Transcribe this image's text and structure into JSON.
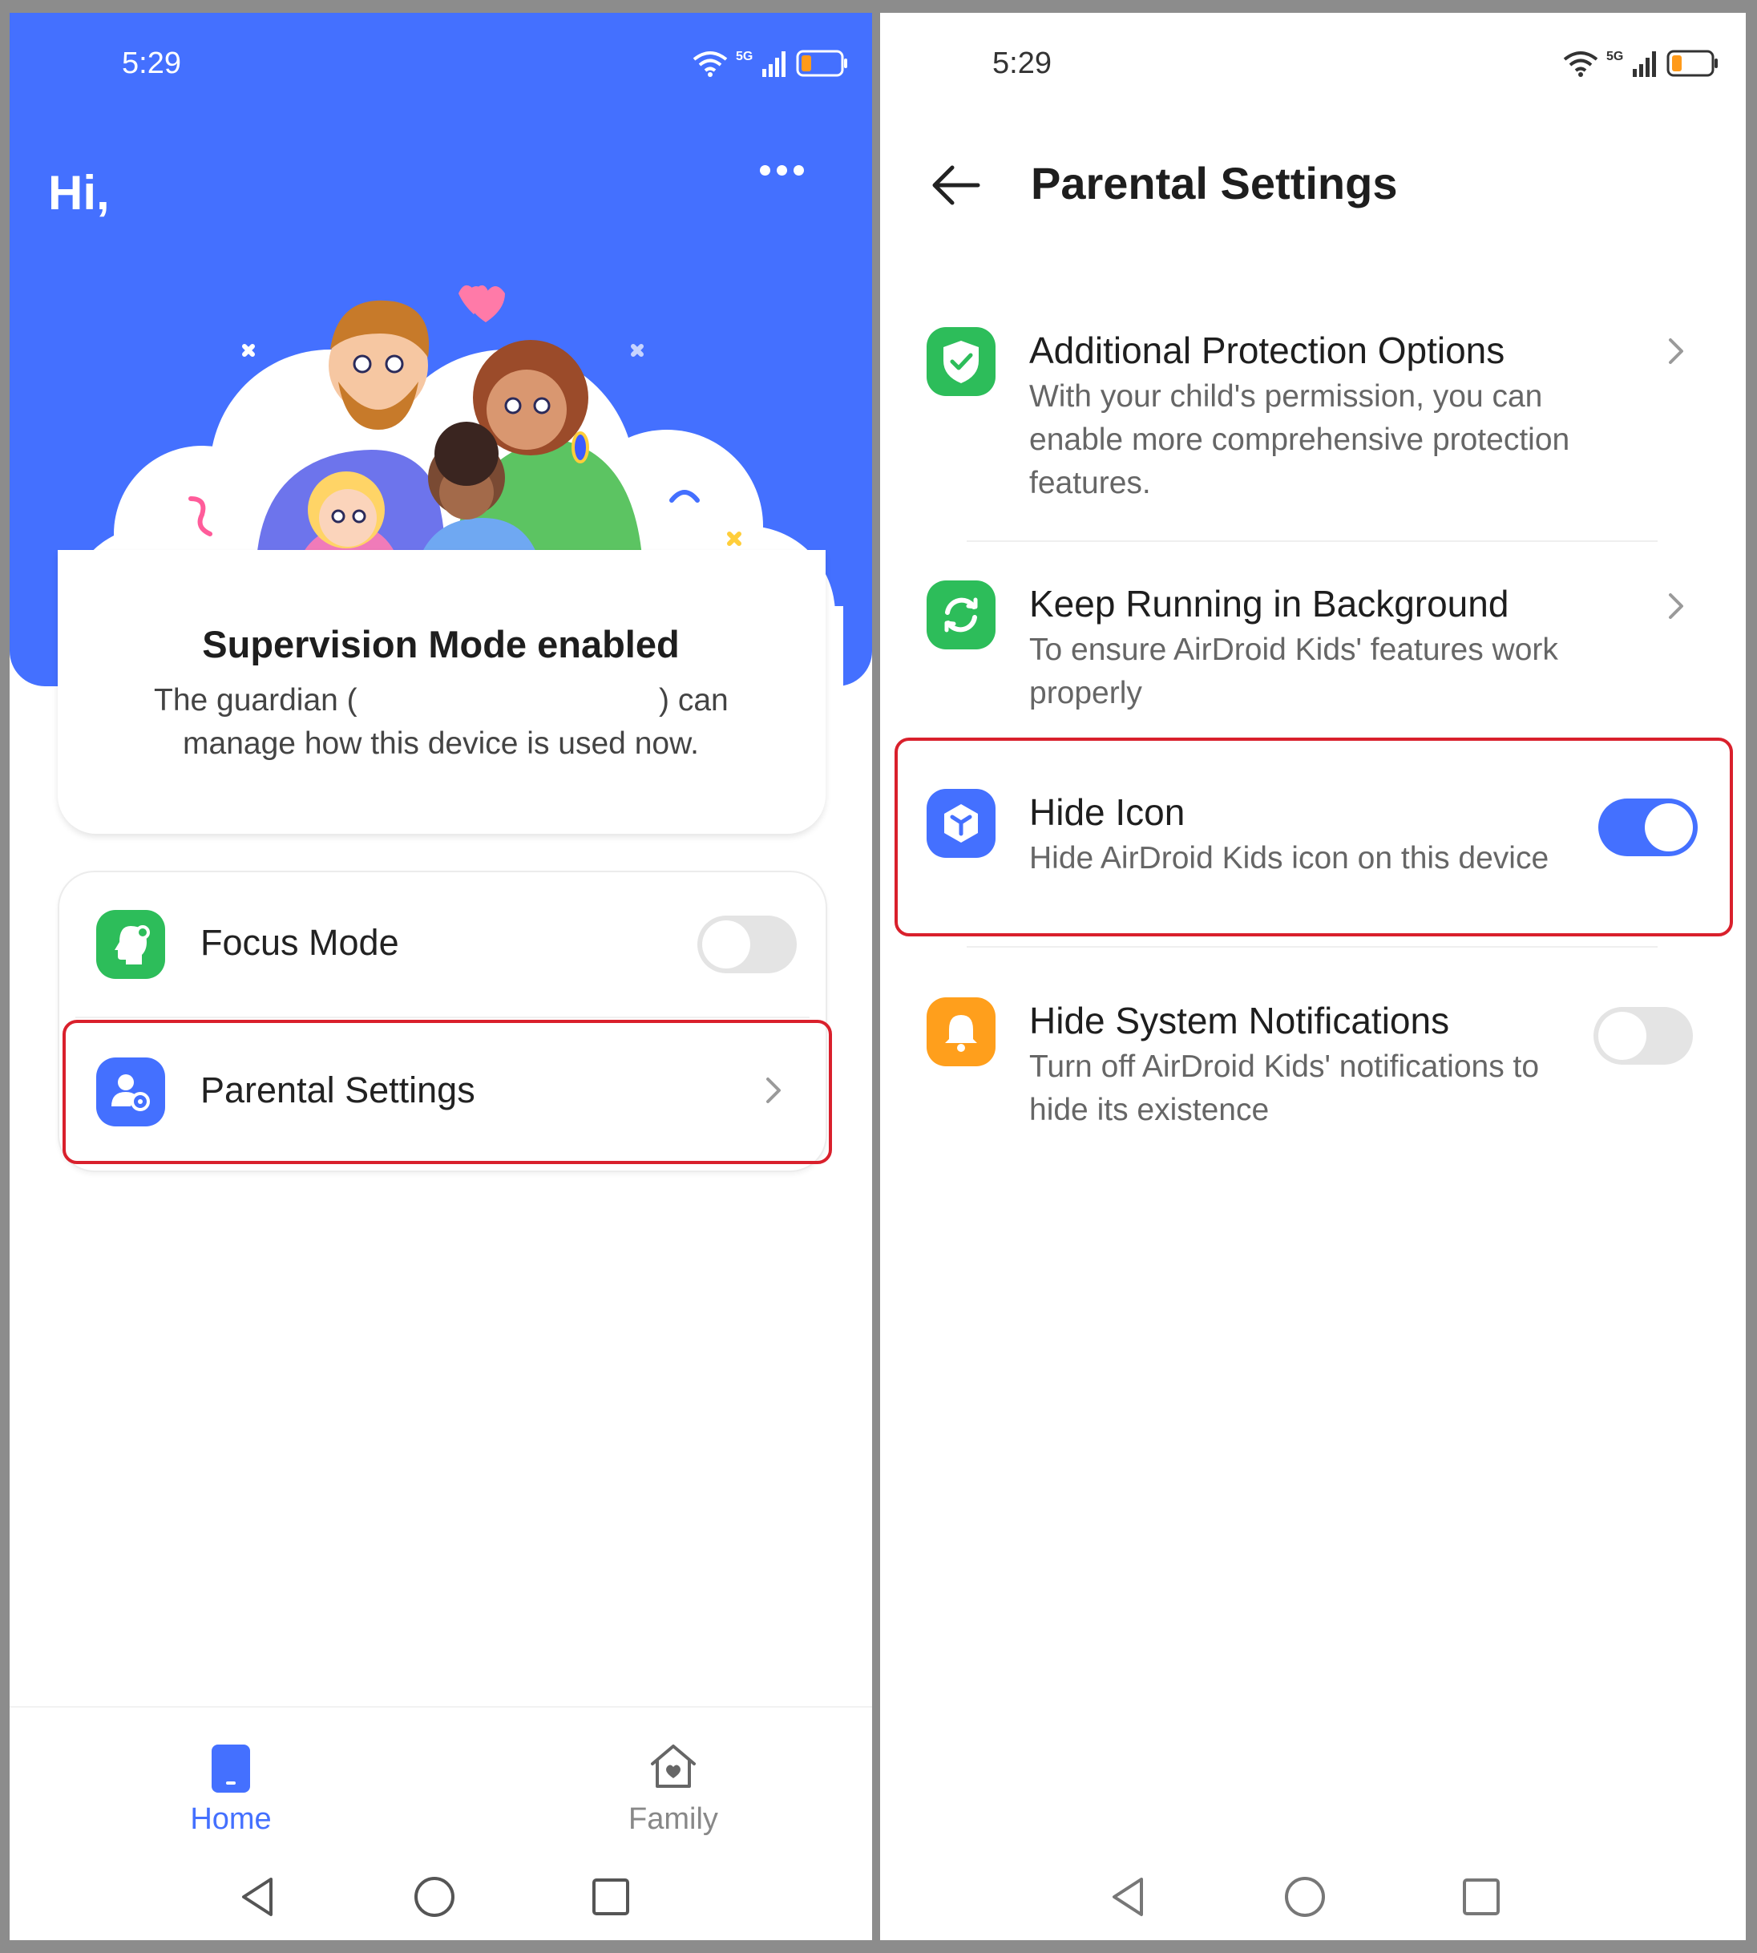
{
  "left": {
    "status": {
      "time": "5:29",
      "network": "5G"
    },
    "header": {
      "greeting": "Hi,"
    },
    "supervision": {
      "title": "Supervision Mode enabled",
      "text_prefix": "The guardian (",
      "text_suffix": ") can",
      "text_line2": "manage how this device is used now."
    },
    "menu": {
      "focus_mode": {
        "label": "Focus Mode",
        "enabled": false
      },
      "parental_settings": {
        "label": "Parental Settings"
      }
    },
    "tabs": [
      {
        "label": "Home",
        "active": true
      },
      {
        "label": "Family",
        "active": false
      }
    ]
  },
  "right": {
    "status": {
      "time": "5:29",
      "network": "5G"
    },
    "header": {
      "title": "Parental Settings"
    },
    "items": [
      {
        "title": "Additional Protection Options",
        "desc": "With your child's permission, you can enable more comprehensive protection features.",
        "control": "chevron"
      },
      {
        "title": "Keep Running in Background",
        "desc": "To ensure AirDroid Kids' features work properly",
        "control": "chevron"
      },
      {
        "title": "Hide Icon",
        "desc": "Hide AirDroid Kids icon on this device",
        "control": "toggle",
        "enabled": true
      },
      {
        "title": "Hide System Notifications",
        "desc": "Turn off AirDroid Kids' notifications to hide its existence",
        "control": "toggle",
        "enabled": false
      }
    ]
  },
  "colors": {
    "brand_blue": "#4470ff",
    "green": "#2dbd5a",
    "orange": "#ff9f1c",
    "highlight_red": "#d9202c",
    "toggle_off": "#e4e4e4"
  }
}
